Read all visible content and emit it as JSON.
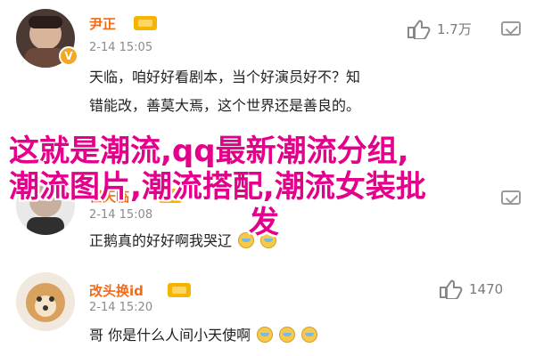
{
  "comments": [
    {
      "username": "尹正",
      "time": "2-14 15:05",
      "likes": "1.7万",
      "text_lines": [
        "天临，咱好好看剧本，当个好演员好不？知",
        "错能改，善莫大焉，这个世界还是善良的。"
      ],
      "avatar_icon": "avatar-yin-zheng",
      "badge": "v-badge",
      "accent": "#f06b1a"
    },
    {
      "username": "翟天临",
      "time": "2-14 15:08",
      "likes": "",
      "text_lines": [
        "正鹅真的好好啊我哭辽"
      ],
      "avatar_icon": "avatar-zhai",
      "accent": "#f06b1a"
    },
    {
      "username": "改头换id",
      "time": "2-14 15:20",
      "likes": "1470",
      "text_lines": [
        "哥 你是什么人间小天使啊"
      ],
      "avatar_icon": "avatar-dog",
      "accent": "#f06b1a"
    }
  ],
  "overlay": {
    "line1": "这就是潮流,qq最新潮流分组,",
    "line2": "潮流图片,潮流搭配,潮流女装批",
    "line3": "发",
    "color": "#e4008a"
  }
}
